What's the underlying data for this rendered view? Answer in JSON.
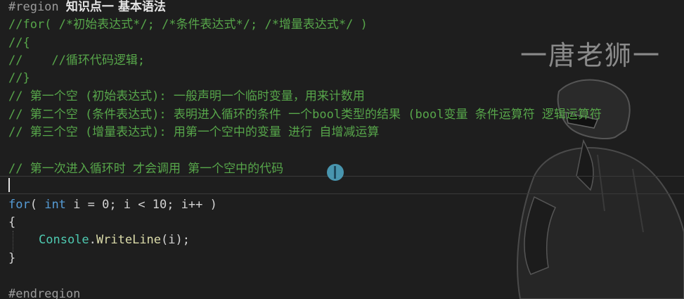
{
  "watermark": "一唐老狮一",
  "code": {
    "region_keyword": "#region",
    "region_title": "知识点一 基本语法",
    "c_for_syntax": "//for( /*初始表达式*/; /*条件表达式*/; /*增量表达式*/ )",
    "c_open": "//{",
    "c_body": "//    //循环代码逻辑;",
    "c_close": "//}",
    "c_slot1": "// 第一个空 (初始表达式): 一般声明一个临时变量，用来计数用",
    "c_slot2": "// 第二个空 (条件表达式): 表明进入循环的条件 一个bool类型的结果 (bool变量 条件运算符 逻辑运算符",
    "c_slot3": "// 第三个空 (增量表达式): 用第一个空中的变量 进行 自增减运算",
    "c_first_entry": "// 第一次进入循环时 才会调用 第一个空中的代码",
    "for_kw": "for",
    "for_open": "( ",
    "int_kw": "int",
    "for_rest": " i = 0; i < 10; i++ )",
    "brace_open": "{",
    "console_cls": "Console",
    "dot": ".",
    "writeline": "WriteLine",
    "call_args": "(i);",
    "brace_close": "}",
    "endregion": "#endregion"
  },
  "colors": {
    "background": "#1e1e1e",
    "comment": "#57a64a",
    "keyword": "#569cd6",
    "class": "#4ec9b0",
    "method": "#dcdcaa",
    "text": "#d4d4d4"
  }
}
